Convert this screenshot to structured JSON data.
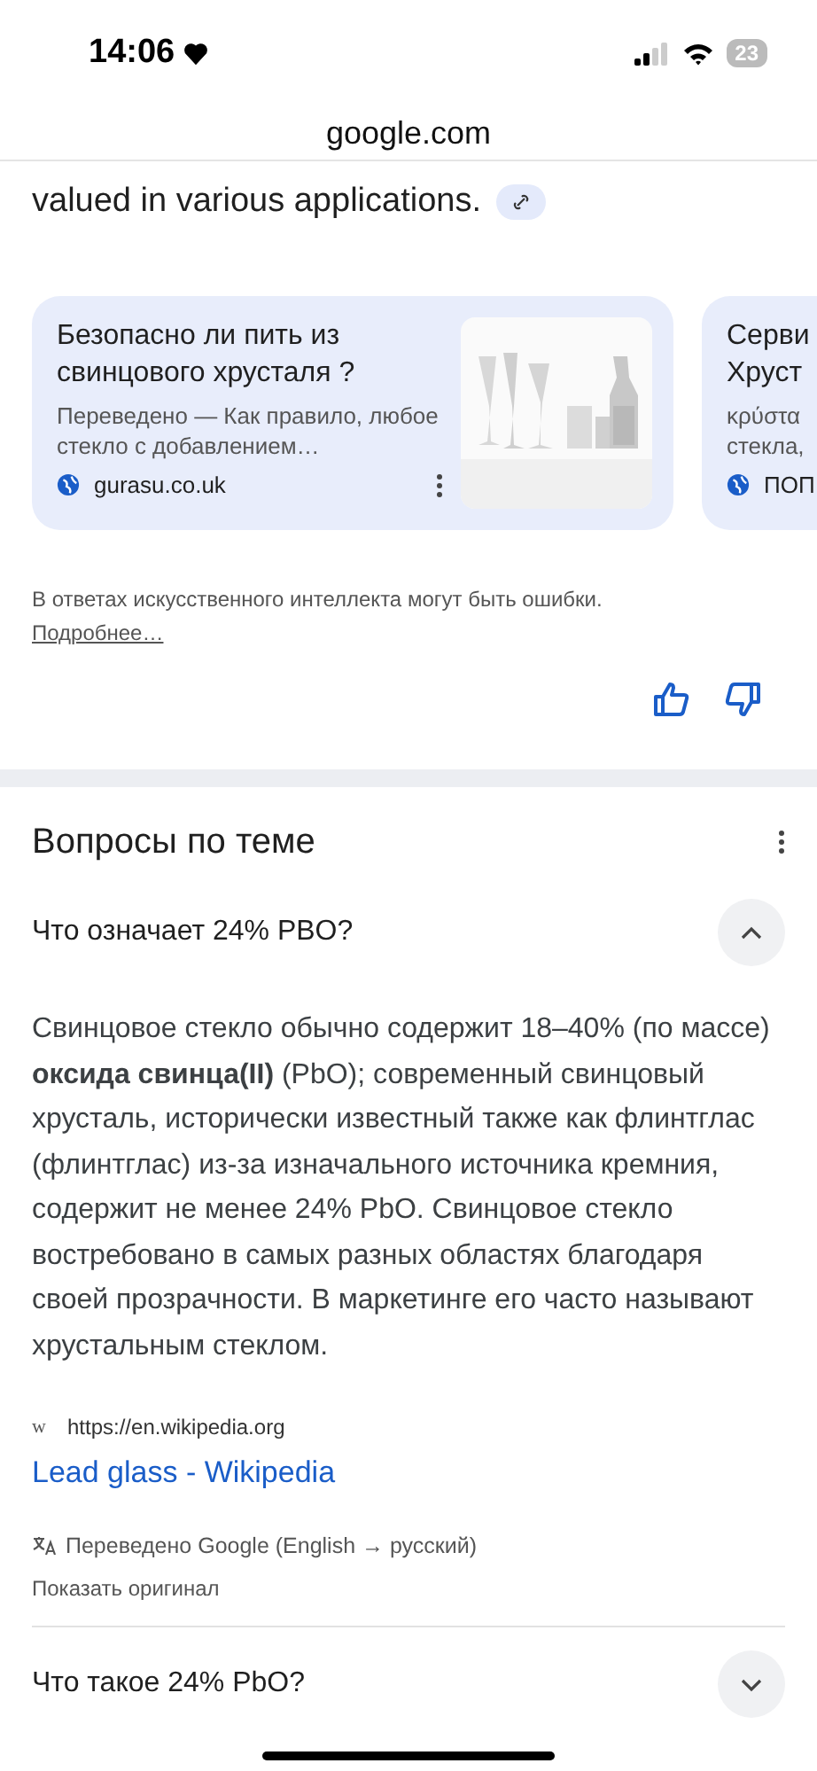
{
  "status_bar": {
    "time": "14:06",
    "battery": "23"
  },
  "address_bar": {
    "url": "google.com"
  },
  "overview": {
    "text_tail": "valued in various applications."
  },
  "source_cards": [
    {
      "title": "Безопасно ли пить из свинцового хрусталя ?",
      "snippet": "Переведено — Как правило, любое стекло с добавлением…",
      "site": "gurasu.co.uk",
      "has_thumbnail": true
    },
    {
      "title": "Серви Хруст",
      "snippet": "κρύστα стекла,",
      "site": "ПОП",
      "has_thumbnail": false
    }
  ],
  "disclaimer": {
    "text": "В ответах искусственного интеллекта могут быть ошибки.",
    "link": "Подробнее…"
  },
  "related_questions": {
    "title": "Вопросы по теме",
    "items": [
      {
        "question": "Что означает 24% PBO?",
        "expanded": true,
        "answer": "Свинцовое стекло обычно содержит 18–40% (по массе) **оксида свинца(II)** (PbO); современный свинцовый хрусталь, исторически известный также как флинтглас (флинтглас) из-за изначального источника кремния, содержит не менее 24% PbO. Свинцовое стекло востребовано в самых разных областях благодаря своей прозрачности. В маркетинге его часто называют хрустальным стеклом.",
        "source_favicon": "w",
        "source_url": "https://en.wikipedia.org",
        "source_title": "Lead glass - Wikipedia",
        "translation_note": "Переведено Google (English → русский)",
        "show_original": "Показать оригинал"
      },
      {
        "question": "Что такое 24% PbO?",
        "expanded": false
      }
    ]
  }
}
